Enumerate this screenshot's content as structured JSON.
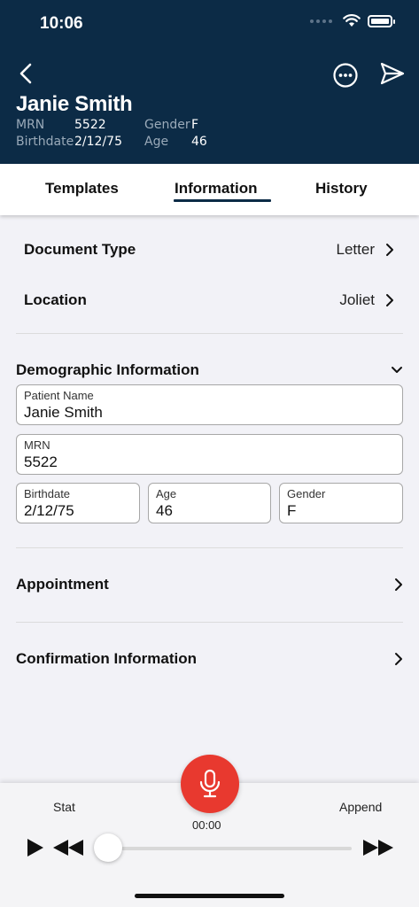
{
  "status": {
    "time": "10:06"
  },
  "patient": {
    "name": "Janie Smith",
    "mrn_label": "MRN",
    "mrn": "5522",
    "gender_label": "Gender",
    "gender": "F",
    "birthdate_label": "Birthdate",
    "birthdate": "2/12/75",
    "age_label": "Age",
    "age": "46"
  },
  "tabs": [
    {
      "label": "Templates"
    },
    {
      "label": "Information",
      "active": true
    },
    {
      "label": "History"
    }
  ],
  "document_type": {
    "label": "Document Type",
    "value": "Letter"
  },
  "location": {
    "label": "Location",
    "value": "Joliet"
  },
  "demographics": {
    "title": "Demographic Information",
    "patient_name": {
      "label": "Patient Name",
      "value": "Janie Smith"
    },
    "mrn": {
      "label": "MRN",
      "value": "5522"
    },
    "birthdate": {
      "label": "Birthdate",
      "value": "2/12/75"
    },
    "age": {
      "label": "Age",
      "value": "46"
    },
    "gender": {
      "label": "Gender",
      "value": "F"
    }
  },
  "appointment": {
    "label": "Appointment"
  },
  "confirmation": {
    "label": "Confirmation Information"
  },
  "player": {
    "stat_label": "Stat",
    "append_label": "Append",
    "timer": "00:00",
    "progress": 0
  },
  "colors": {
    "header_bg": "#0c2b46",
    "accent": "#0c2b46",
    "record": "#e8392f"
  }
}
